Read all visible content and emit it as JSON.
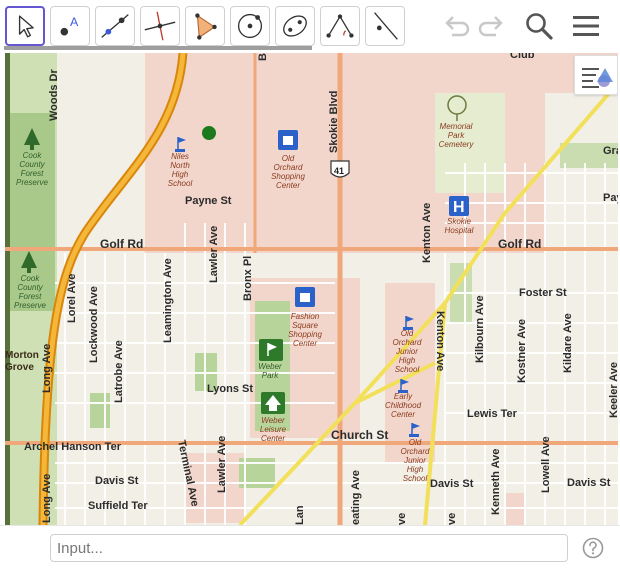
{
  "toolbar": {
    "tools": [
      {
        "id": "move",
        "icon": "cursor-arrow-icon"
      },
      {
        "id": "point",
        "icon": "point-icon"
      },
      {
        "id": "line",
        "icon": "line-icon"
      },
      {
        "id": "perpendicular",
        "icon": "perpendicular-line-icon"
      },
      {
        "id": "polygon",
        "icon": "polygon-icon"
      },
      {
        "id": "circle",
        "icon": "circle-center-point-icon"
      },
      {
        "id": "ellipse",
        "icon": "ellipse-icon"
      },
      {
        "id": "angle",
        "icon": "angle-icon"
      },
      {
        "id": "reflect",
        "icon": "reflect-about-line-icon"
      }
    ],
    "point_tool_letter": "A",
    "active_tool": "move",
    "accent_color": "#6557d2"
  },
  "map": {
    "streets": {
      "woods_dr": "Woods Dr",
      "skokie_blvd": "Skokie Blvd",
      "route_41": "41",
      "payne_st": "Payne St",
      "golf_rd_west": "Golf Rd",
      "golf_rd_east": "Golf Rd",
      "lawler_ave_north": "Lawler Ave",
      "bronx_pl": "Bronx Pl",
      "kenton_ave_north": "Kenton Ave",
      "foster_st": "Foster St",
      "lorel_ave": "Lorel Ave",
      "lockwood_ave": "Lockwood Ave",
      "leamington_ave": "Leamington Ave",
      "latrobe_ave": "Latrobe Ave",
      "long_ave_north": "Long Ave",
      "lyons_st": "Lyons St",
      "kenton_ave": "Kenton Ave",
      "kilbourn_ave": "Kilbourn Ave",
      "kostner_ave": "Kostner Ave",
      "kildare_ave": "Kildare Ave",
      "keeler_ave": "Keeler Ave",
      "lewis_ter": "Lewis Ter",
      "archel_hanson_ter": "Archel Hanson Ter",
      "church_st": "Church St",
      "terminal_ave": "Terminal Ave",
      "lawler_ave_south": "Lawler Ave",
      "davis_st_west": "Davis St",
      "davis_st_mid": "Davis St",
      "davis_st_east": "Davis St",
      "suffield_ter": "Suffield Ter",
      "long_ave_south": "Long Ave",
      "keating_ave": "eating Ave",
      "kenneth_ave": "Kenneth Ave",
      "lowell_ave": "Lowell Ave",
      "partial_gra": "Gra",
      "partial_pay": "Pay",
      "partial_club": "Club",
      "partial_b": "B",
      "partial_lan": "Lan",
      "partial_ve": "ve",
      "partial_ve2": "ve"
    },
    "places": {
      "niles_north": [
        "Niles",
        "North",
        "High",
        "School"
      ],
      "old_orchard": [
        "Old",
        "Orchard",
        "Shopping",
        "Center"
      ],
      "memorial_park": [
        "Memorial",
        "Park",
        "Cemetery"
      ],
      "cook_forest_1": [
        "Cook",
        "County",
        "Forest",
        "Preserve"
      ],
      "cook_forest_2": [
        "Cook",
        "County",
        "Forest",
        "Preserve"
      ],
      "skokie_hospital": [
        "Skokie",
        "Hospital"
      ],
      "fashion_square": [
        "Fashion",
        "Square",
        "Shopping",
        "Center"
      ],
      "weber_park": [
        "Weber",
        "Park"
      ],
      "weber_leisure": [
        "Weber",
        "Leisure",
        "Center"
      ],
      "old_orchard_jr_high": [
        "Old",
        "Orchard",
        "Junior",
        "High",
        "School"
      ],
      "early_childhood": [
        "Early",
        "Childhood",
        "Center"
      ],
      "old_orchard_jr_high_2": [
        "Old",
        "Orchard",
        "Junior",
        "High",
        "School"
      ],
      "morton_grove": [
        "Morton",
        "Grove"
      ]
    },
    "hospital_letter": "H",
    "point_color": "#1c7a1c"
  },
  "input_bar": {
    "placeholder": "Input...",
    "value": ""
  }
}
